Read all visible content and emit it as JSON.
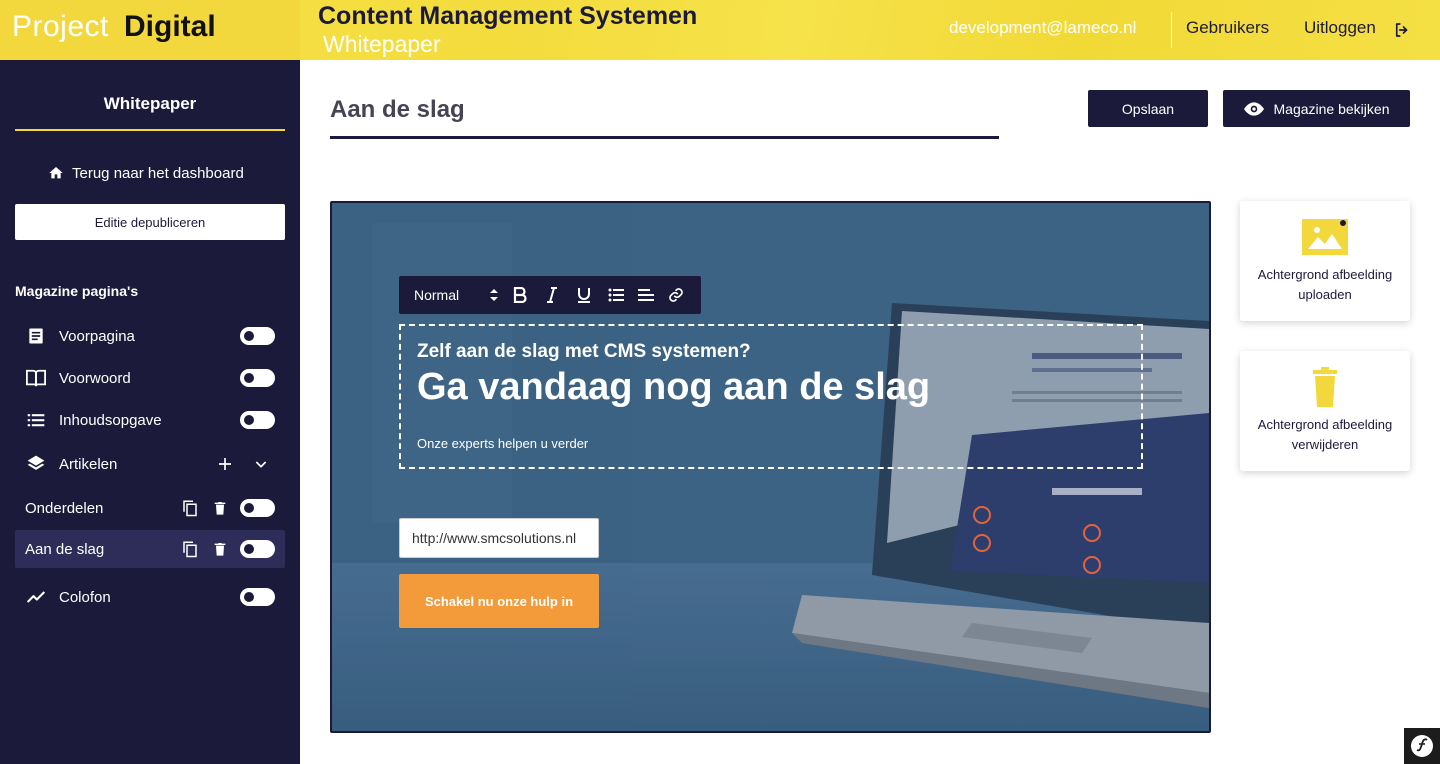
{
  "header": {
    "logo_light": "Project",
    "logo_bold": "Digital",
    "title": "Content Management Systemen",
    "subtitle": "Whitepaper",
    "email": "development@lameco.nl",
    "users_label": "Gebruikers",
    "logout_label": "Uitloggen"
  },
  "sidebar": {
    "title": "Whitepaper",
    "back_label": "Terug naar het dashboard",
    "depublish_label": "Editie depubliceren",
    "section_title": "Magazine pagina's",
    "items": [
      {
        "label": "Voorpagina",
        "icon": "document-icon"
      },
      {
        "label": "Voorwoord",
        "icon": "book-icon"
      },
      {
        "label": "Inhoudsopgave",
        "icon": "list-icon"
      },
      {
        "label": "Artikelen",
        "icon": "layers-icon"
      },
      {
        "label": "Onderdelen",
        "icon": ""
      },
      {
        "label": "Aan de slag",
        "icon": ""
      },
      {
        "label": "Colofon",
        "icon": "trend-icon"
      }
    ]
  },
  "main": {
    "page_title": "Aan de slag",
    "save_label": "Opslaan",
    "view_label": "Magazine bekijken"
  },
  "editor": {
    "format_value": "Normal",
    "heading_small": "Zelf aan de slag met CMS systemen?",
    "heading_large": "Ga vandaag nog aan de slag",
    "paragraph": "Onze experts helpen u verder",
    "url_value": "http://www.smcsolutions.nl",
    "cta_label": "Schakel nu onze hulp in"
  },
  "cards": {
    "upload_label": "Achtergrond afbeelding uploaden",
    "delete_label": "Achtergrond afbeelding verwijderen"
  },
  "colors": {
    "navy": "#1c1a3b",
    "yellow": "#f2d83c",
    "orange": "#f39a3a"
  }
}
